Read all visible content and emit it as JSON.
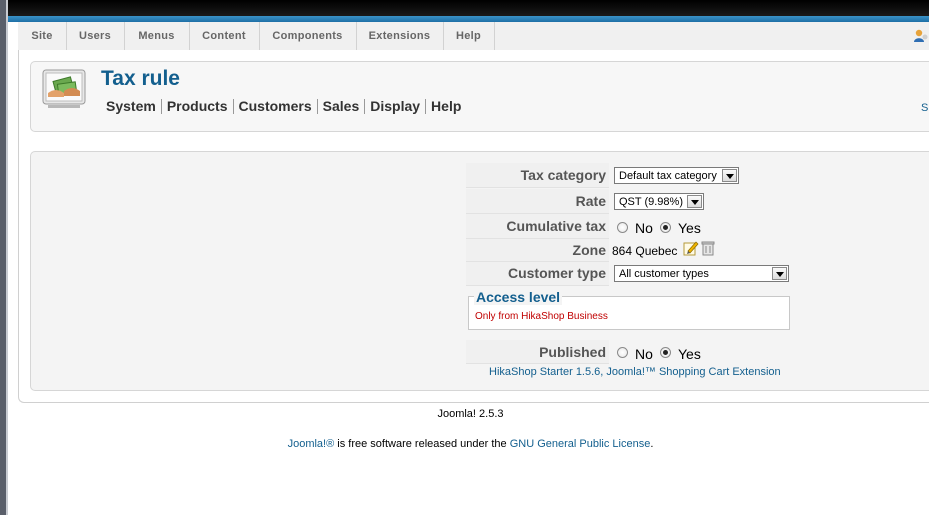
{
  "menubar": {
    "items": [
      {
        "label": "Site"
      },
      {
        "label": "Users"
      },
      {
        "label": "Menus"
      },
      {
        "label": "Content"
      },
      {
        "label": "Components"
      },
      {
        "label": "Extensions"
      },
      {
        "label": "Help"
      }
    ],
    "user_icon": "user-icon"
  },
  "header": {
    "title": "Tax rule",
    "icon": "tax-rule-icon",
    "submenu": [
      {
        "label": "System"
      },
      {
        "label": "Products"
      },
      {
        "label": "Customers"
      },
      {
        "label": "Sales"
      },
      {
        "label": "Display"
      },
      {
        "label": "Help"
      }
    ],
    "right_link": "S"
  },
  "form": {
    "tax_category": {
      "label": "Tax category",
      "value": "Default tax category"
    },
    "rate": {
      "label": "Rate",
      "value": "QST (9.98%)"
    },
    "cumulative_tax": {
      "label": "Cumulative tax",
      "no": "No",
      "yes": "Yes",
      "selected": "Yes"
    },
    "zone": {
      "label": "Zone",
      "value": "864 Quebec"
    },
    "customer_type": {
      "label": "Customer type",
      "value": "All customer types"
    },
    "access_level": {
      "legend": "Access level",
      "note": "Only from HikaShop Business"
    },
    "published": {
      "label": "Published",
      "no": "No",
      "yes": "Yes",
      "selected": "Yes"
    },
    "credit": "HikaShop Starter 1.5.6, Joomla!™ Shopping Cart Extension"
  },
  "footer": {
    "version": "Joomla! 2.5.3",
    "license_link1": "Joomla!®",
    "license_mid": " is free software released under the ",
    "license_link2": "GNU General Public License",
    "license_end": "."
  },
  "colors": {
    "accent": "#135f8e",
    "stripe": "#1e6fa6",
    "warning": "#c00000"
  }
}
